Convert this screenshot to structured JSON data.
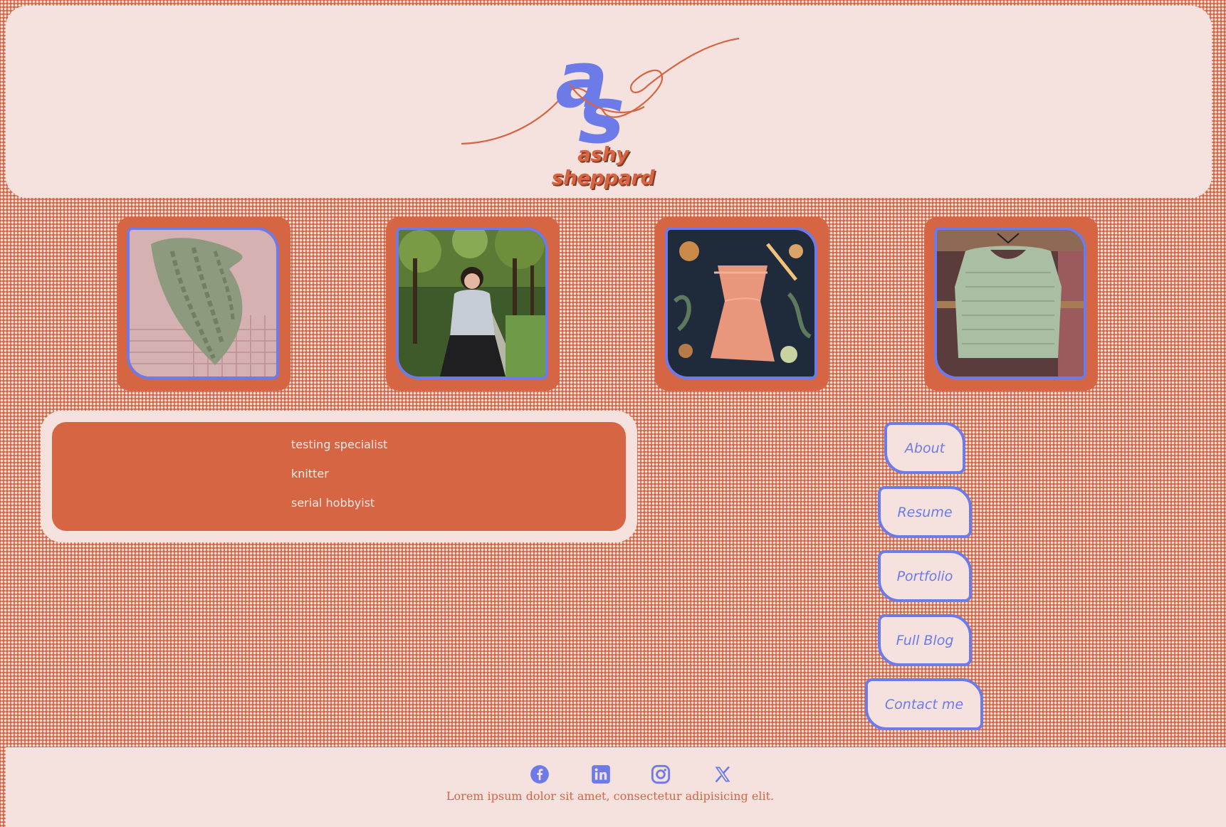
{
  "brand": {
    "monogram": "as",
    "name": "ashy sheppard"
  },
  "photos": [
    {
      "name": "cabled-knit-hat-photo",
      "subject": "green cable-knit hat on pink knit blanket"
    },
    {
      "name": "portrait-photo",
      "subject": "person standing in a tree-lined park"
    },
    {
      "name": "knit-tank-top-photo",
      "subject": "peach knit tank top on hanger over floral fabric"
    },
    {
      "name": "knit-vest-photo",
      "subject": "sage green knit vest on hanger"
    }
  ],
  "taglines": [
    "testing specialist",
    "knitter",
    "serial hobbyist"
  ],
  "nav": {
    "about": "About",
    "resume": "Resume",
    "portfolio": "Portfolio",
    "blog": "Full Blog",
    "contact": "Contact me"
  },
  "social": [
    "facebook-icon",
    "linkedin-icon",
    "instagram-icon",
    "x-icon"
  ],
  "footer": {
    "text": "Lorem ipsum dolor sit amet, consectetur adipisicing elit."
  },
  "colors": {
    "background": "#d66544",
    "panel": "#f5e1de",
    "accent": "#6c7be8"
  }
}
